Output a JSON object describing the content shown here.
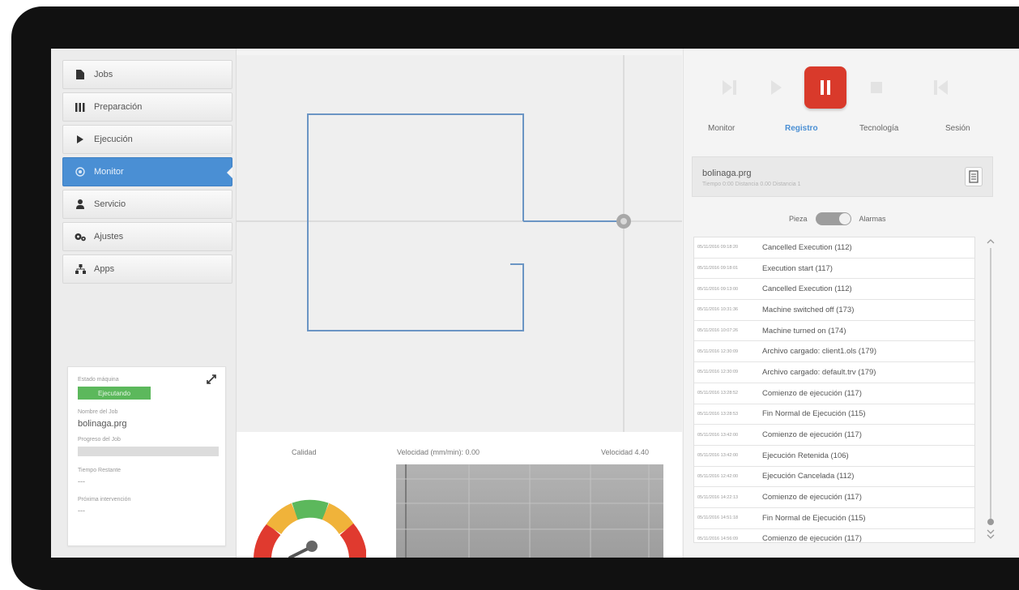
{
  "nav": {
    "items": [
      {
        "label": "Jobs",
        "icon": "file-icon"
      },
      {
        "label": "Preparación",
        "icon": "bars-icon"
      },
      {
        "label": "Ejecución",
        "icon": "play-icon"
      },
      {
        "label": "Monitor",
        "icon": "monitor-icon",
        "active": true
      },
      {
        "label": "Servicio",
        "icon": "person-icon"
      },
      {
        "label": "Ajustes",
        "icon": "gears-icon"
      },
      {
        "label": "Apps",
        "icon": "sitemap-icon"
      }
    ]
  },
  "status_card": {
    "state_label": "Estado máquina",
    "state_value": "Ejecutando",
    "job_label": "Nombre del Job",
    "job_value": "bolinaga.prg",
    "progress_label": "Progreso del Job",
    "time_label": "Tiempo Restante",
    "time_value": "---",
    "next_label": "Próxima intervención",
    "next_value": "---"
  },
  "gauges": {
    "quality_label": "Calidad",
    "speed_label": "Velocidad (mm/min): 0.00",
    "speed_value_label": "Velocidad 4.40"
  },
  "controls": {
    "buttons": [
      "skip-forward-icon",
      "play-icon",
      "pause-icon",
      "stop-icon",
      "rewind-icon"
    ]
  },
  "tabs": [
    {
      "label": "Monitor"
    },
    {
      "label": "Registro",
      "active": true
    },
    {
      "label": "Tecnología"
    },
    {
      "label": "Sesión"
    }
  ],
  "file": {
    "name": "bolinaga.prg",
    "subtitle": "Tiempo 0:00 Distancia 0.00 Distancia 1"
  },
  "toggle": {
    "left": "Pieza",
    "right": "Alarmas"
  },
  "log": [
    {
      "date": "05/11/2016 09:18:20",
      "text": "Cancelled Execution (112)"
    },
    {
      "date": "05/11/2016 09:18:01",
      "text": "Execution start (117)"
    },
    {
      "date": "05/11/2016 09:13:00",
      "text": "Cancelled Execution (112)"
    },
    {
      "date": "05/11/2016 10:31:36",
      "text": "Machine switched off (173)"
    },
    {
      "date": "05/11/2016 10:07:26",
      "text": "Machine turned on (174)"
    },
    {
      "date": "05/11/2016 12:30:09",
      "text": "Archivo cargado: client1.ols (179)"
    },
    {
      "date": "05/11/2016 12:30:09",
      "text": "Archivo cargado: default.trv (179)"
    },
    {
      "date": "05/11/2016 13:28:52",
      "text": "Comienzo de ejecución (117)"
    },
    {
      "date": "05/11/2016 13:28:53",
      "text": "Fin Normal de Ejecución (115)"
    },
    {
      "date": "05/11/2016 13:42:00",
      "text": "Comienzo de ejecución (117)"
    },
    {
      "date": "05/11/2016 13:42:00",
      "text": "Ejecución Retenida (106)"
    },
    {
      "date": "05/11/2016 12:42:00",
      "text": "Ejecución Cancelada (112)"
    },
    {
      "date": "05/11/2016 14:22:13",
      "text": "Comienzo de ejecución (117)"
    },
    {
      "date": "05/11/2016 14:51:18",
      "text": "Fin Normal de Ejecución (115)"
    },
    {
      "date": "05/11/2016 14:56:09",
      "text": "Comienzo de ejecución (117)"
    }
  ],
  "colors": {
    "accent": "#4a8fd4",
    "pause": "#d93a2b",
    "running": "#5cb85c"
  }
}
